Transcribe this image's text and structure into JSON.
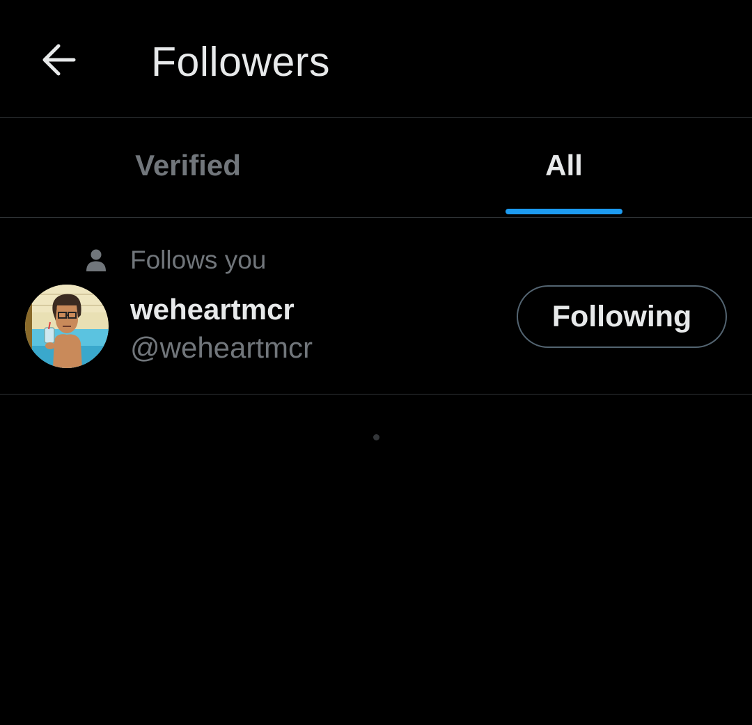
{
  "header": {
    "title": "Followers",
    "back_icon": "arrow-left-icon"
  },
  "tabs": [
    {
      "label": "Verified",
      "active": false
    },
    {
      "label": "All",
      "active": true
    }
  ],
  "colors": {
    "accent": "#1d9bf0",
    "background": "#000000",
    "text_primary": "#e7e9ea",
    "text_secondary": "#71767b",
    "divider": "#2f3336"
  },
  "followers": [
    {
      "social_context": "Follows you",
      "social_icon": "person-icon",
      "display_name": "weheartmcr",
      "handle": "@weheartmcr",
      "follow_button_label": "Following",
      "avatar_icon": "cartoon-avatar"
    }
  ],
  "loading_indicator": "loading-dot"
}
